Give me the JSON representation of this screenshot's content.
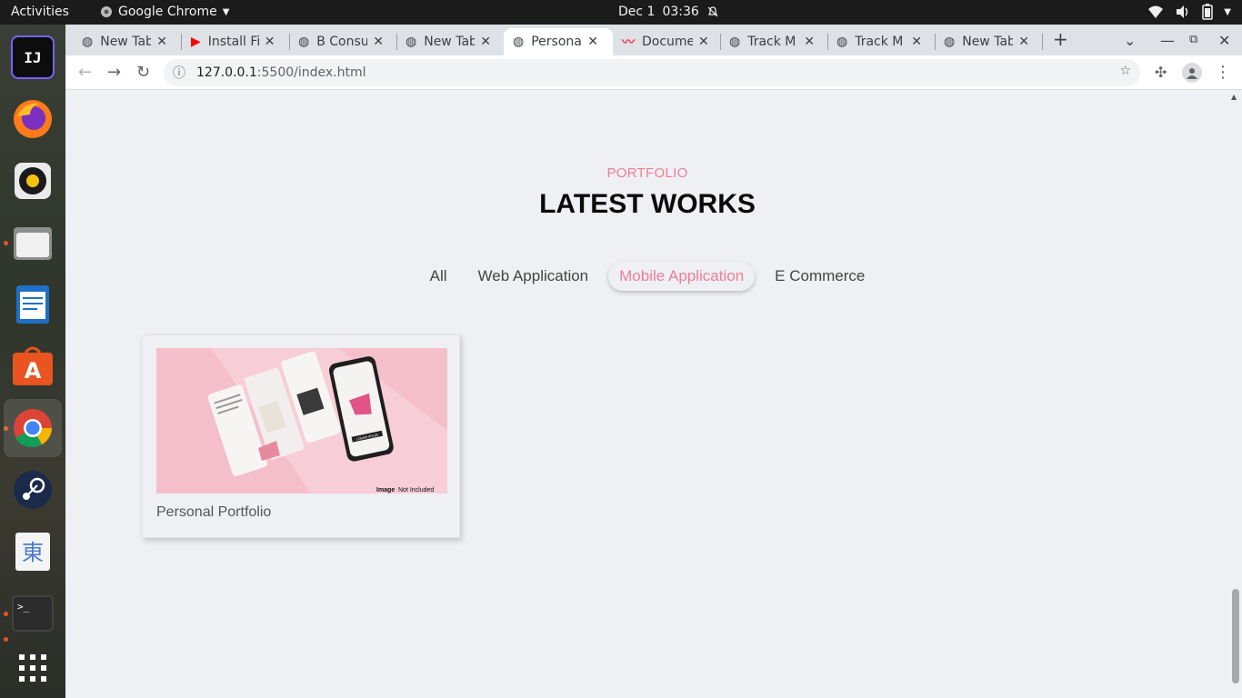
{
  "topbar": {
    "activities": "Activities",
    "app_name": "Google Chrome",
    "date": "Dec 1",
    "time": "03:36"
  },
  "dock": {
    "items": [
      "intellij-icon",
      "firefox-icon",
      "rhythmbox-icon",
      "files-icon",
      "writer-icon",
      "software-icon",
      "chrome-icon",
      "steam-icon",
      "input-method-icon",
      "terminal-icon",
      "apps-grid-icon"
    ]
  },
  "tabs": [
    {
      "title": "New Tab"
    },
    {
      "title": "Install Fi"
    },
    {
      "title": "B Consu"
    },
    {
      "title": "New Tab"
    },
    {
      "title": "Persona"
    },
    {
      "title": "Docume"
    },
    {
      "title": "Track M"
    },
    {
      "title": "Track M"
    },
    {
      "title": "New Tab"
    }
  ],
  "address": {
    "host": "127.0.0.1",
    "path": ":5500/index.html"
  },
  "page": {
    "subtitle": "PORTFOLIO",
    "title": "LATEST WORKS",
    "filters": [
      "All",
      "Web Application",
      "Mobile Application",
      "E Commerce"
    ],
    "active_filter": "Mobile Application",
    "card": {
      "caption": "Personal Portfolio",
      "image_tag_bold": "Image",
      "image_tag_rest": " Not Included",
      "phone_button": "LOREM IPSUM"
    }
  },
  "colors": {
    "accent": "#ee7d98",
    "background": "#eef0f3",
    "thumb_pink": "#f4bfcb"
  }
}
